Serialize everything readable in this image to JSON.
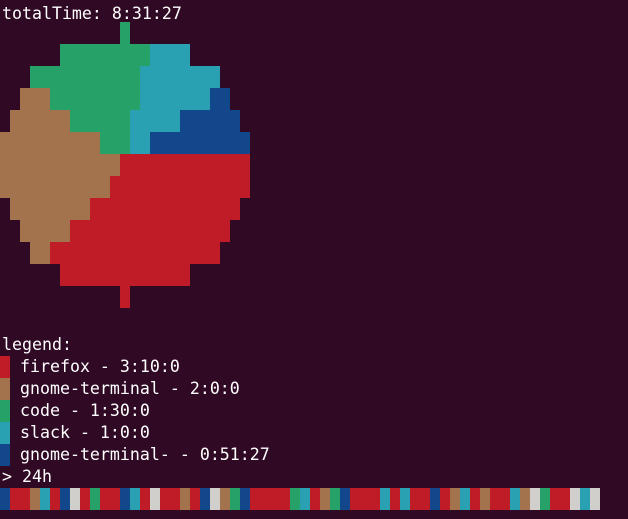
{
  "terminal": {
    "total_time_text": "totalTime: 8:31:27",
    "legend_title": "legend:",
    "prompt_text": "> 24h"
  },
  "chart_data": {
    "type": "pie",
    "title": "totalTime: 8:31:27",
    "series": [
      {
        "name": "firefox",
        "duration": "3:10:0",
        "seconds": 11400,
        "color": "#c01c28"
      },
      {
        "name": "gnome-terminal",
        "duration": "2:0:0",
        "seconds": 7200,
        "color": "#a2734c"
      },
      {
        "name": "code",
        "duration": "1:30:0",
        "seconds": 5400,
        "color": "#26a269"
      },
      {
        "name": "slack",
        "duration": "1:0:0",
        "seconds": 3600,
        "color": "#2aa1b3"
      },
      {
        "name": "gnome-terminal-",
        "duration": "0:51:27",
        "seconds": 3087,
        "color": "#12488b"
      }
    ],
    "legend": [
      "firefox - 3:10:0",
      "gnome-terminal - 2:0:0",
      "code - 1:30:0",
      "slack - 1:0:0",
      "gnome-terminal- - 0:51:27"
    ]
  },
  "timeline": {
    "colors": [
      "#12488b",
      "#c01c28",
      "#c01c28",
      "#a2734c",
      "#2aa1b3",
      "#c01c28",
      "#12488b",
      "#d0cfcc",
      "#c01c28",
      "#26a269",
      "#c01c28",
      "#c01c28",
      "#12488b",
      "#2aa1b3",
      "#c01c28",
      "#d0cfcc",
      "#c01c28",
      "#c01c28",
      "#a2734c",
      "#c01c28",
      "#12488b",
      "#d0cfcc",
      "#a2734c",
      "#26a269",
      "#12488b",
      "#c01c28",
      "#c01c28",
      "#c01c28",
      "#c01c28",
      "#26a269",
      "#2aa1b3",
      "#c01c28",
      "#a2734c",
      "#26a269",
      "#12488b",
      "#c01c28",
      "#c01c28",
      "#c01c28",
      "#2aa1b3",
      "#c01c28",
      "#2aa1b3",
      "#c01c28",
      "#c01c28",
      "#12488b",
      "#c01c28",
      "#a2734c",
      "#2aa1b3",
      "#c01c28",
      "#a2734c",
      "#c01c28",
      "#c01c28",
      "#2aa1b3",
      "#a2734c",
      "#d0cfcc",
      "#26a269",
      "#c01c28",
      "#c01c28",
      "#d0cfcc",
      "#2aa1b3",
      "#d0cfcc"
    ]
  },
  "colors": {
    "background": "#300a24",
    "text": "#ffffff"
  }
}
